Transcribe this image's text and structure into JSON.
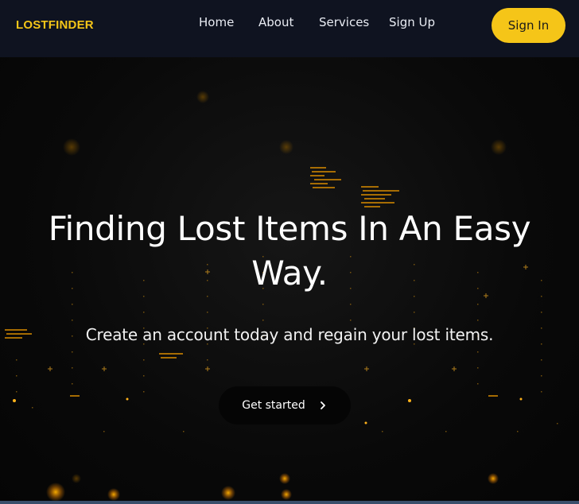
{
  "header": {
    "brand": "LOSTFINDER",
    "nav": [
      {
        "label": "Home"
      },
      {
        "label": "About"
      },
      {
        "label": "Services"
      },
      {
        "label": "Sign Up"
      }
    ],
    "signin_label": "Sign In"
  },
  "hero": {
    "title_line1": "Finding Lost Items In An Easy",
    "title_line2": "Way.",
    "subtitle": "Create an account today and regain your lost items.",
    "cta_label": "Get started",
    "cta_icon": "chevron-right-icon"
  },
  "colors": {
    "accent": "#f5c518",
    "nav_bg": "#0f1320",
    "hero_bg": "#090909"
  }
}
